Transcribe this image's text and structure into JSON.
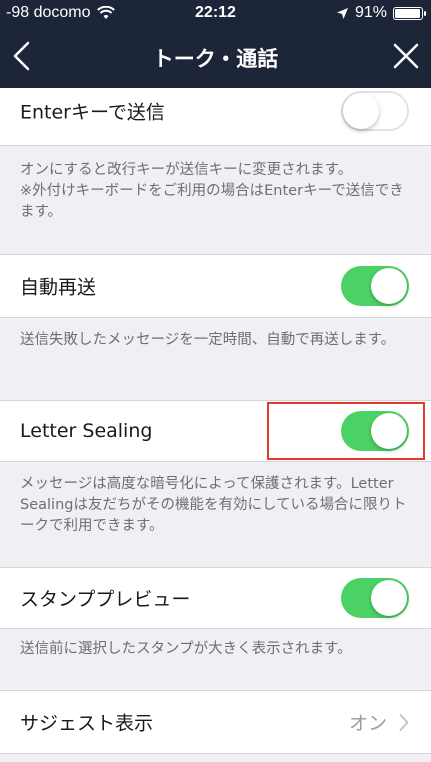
{
  "status_bar": {
    "carrier": "-98 docomo",
    "time": "22:12",
    "battery": "91%"
  },
  "nav": {
    "title": "トーク・通話"
  },
  "settings": [
    {
      "label": "Enterキーで送信",
      "toggle_on": false,
      "description": "オンにすると改行キーが送信キーに変更されます。\n※外付けキーボードをご利用の場合はEnterキーで送信できます。"
    },
    {
      "label": "自動再送",
      "toggle_on": true,
      "description": "送信失敗したメッセージを一定時間、自動で再送します。"
    },
    {
      "label": "Letter Sealing",
      "toggle_on": true,
      "description": "メッセージは高度な暗号化によって保護されます。Letter Sealingは友だちがその機能を有効にしている場合に限りトークで利用できます。"
    },
    {
      "label": "スタンププレビュー",
      "toggle_on": true,
      "description": "送信前に選択したスタンプが大きく表示されます。"
    },
    {
      "label": "サジェスト表示",
      "value": "オン"
    }
  ],
  "colors": {
    "navbar": "#1d2538",
    "toggle_on": "#4cd264",
    "highlight": "#e33a2c"
  }
}
